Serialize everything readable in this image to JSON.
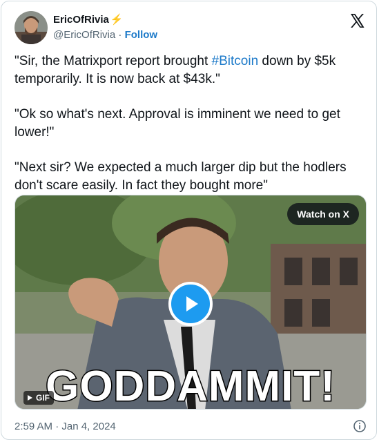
{
  "tweet": {
    "display_name": "EricOfRivia",
    "name_emoji": "⚡",
    "handle": "@EricOfRivia",
    "separator": "·",
    "follow_label": "Follow",
    "paragraph1_before": "\"Sir, the Matrixport report brought ",
    "hashtag": "#Bitcoin",
    "paragraph1_after": " down by $5k temporarily. It is now back at $43k.\"",
    "paragraph2": "\"Ok so what's next. Approval is imminent we need to get lower!\"",
    "paragraph3": "\"Next sir? We expected a much larger dip but the hodlers don't scare easily. In fact they bought more\"",
    "timestamp": "2:59 AM · Jan 4, 2024"
  },
  "media": {
    "watch_label": "Watch on X",
    "caption": "GODDAMMIT!",
    "gif_label": "GIF"
  },
  "colors": {
    "link": "#1d7ac9",
    "play": "#1d9bf0",
    "muted": "#536471"
  },
  "icons": [
    "avatar",
    "x-logo-icon",
    "play-icon",
    "gif-play-icon",
    "info-icon"
  ]
}
